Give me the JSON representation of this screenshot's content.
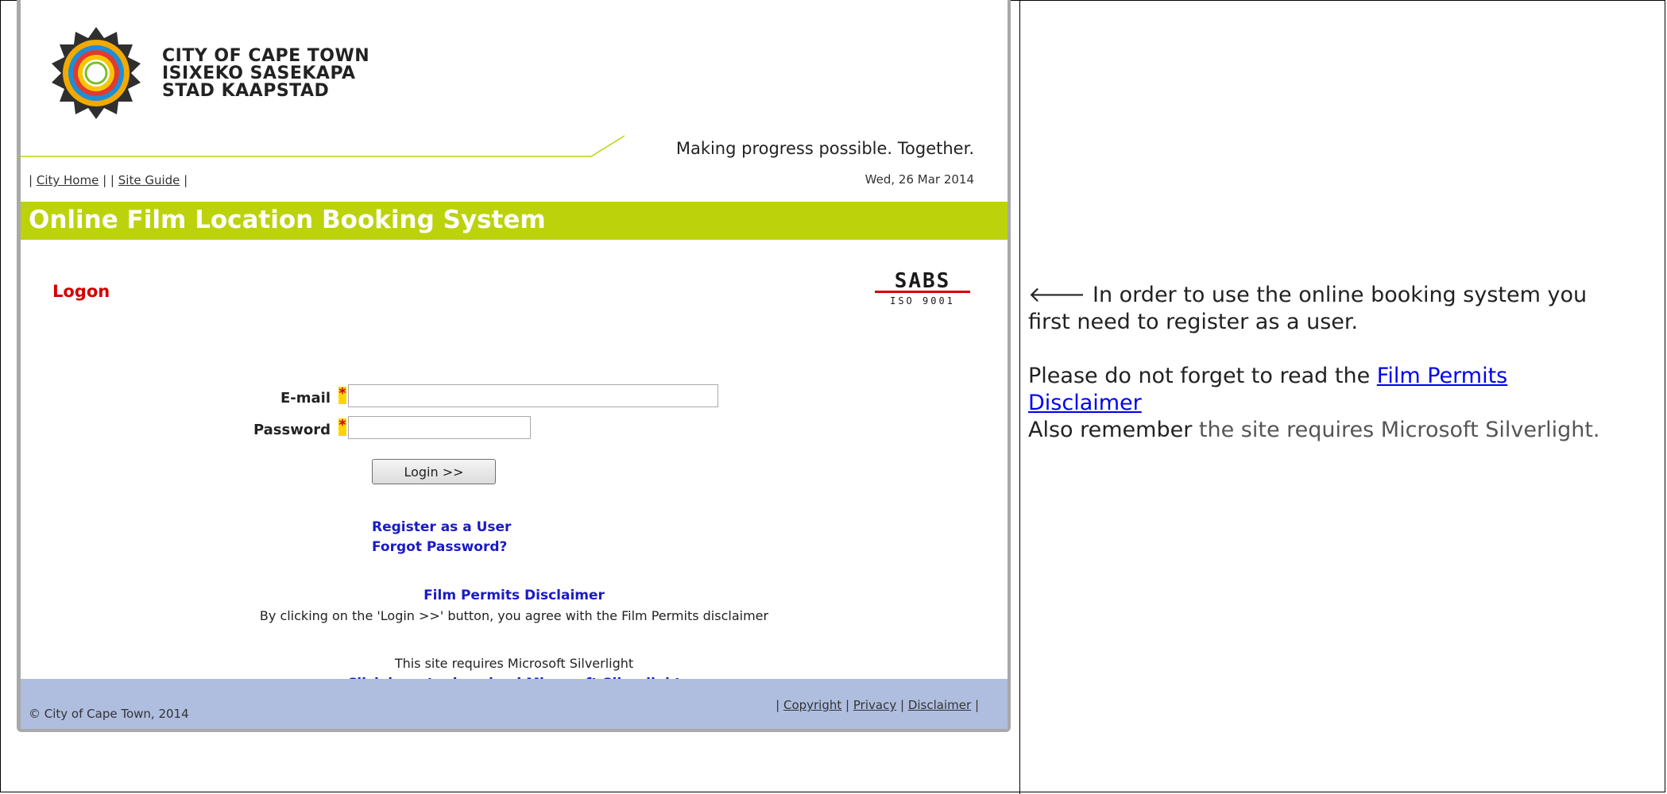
{
  "header": {
    "city_names": [
      "CITY OF CAPE TOWN",
      "ISIXEKO SASEKAPA",
      "STAD KAAPSTAD"
    ],
    "tagline": "Making progress possible. Together.",
    "nav": {
      "sep_open": "|",
      "city_home": "City Home",
      "sep_mid": "| |",
      "site_guide": "Site Guide",
      "sep_close": "|"
    },
    "date": "Wed, 26 Mar 2014"
  },
  "title_bar": {
    "title": "Online Film Location Booking System"
  },
  "logon": {
    "heading": "Logon",
    "sabs_text": "SABS",
    "sabs_sub": "ISO 9001",
    "email_label": "E-mail",
    "password_label": "Password",
    "required_mark": "*",
    "email_value": "",
    "password_value": "",
    "login_button": "Login >>",
    "register_link": "Register as a User",
    "forgot_link": "Forgot Password?",
    "disclaimer_link": "Film Permits Disclaimer",
    "disclaimer_text": "By clicking on the 'Login >>' button, you agree with the Film Permits disclaimer",
    "silverlight_text": "This site requires Microsoft Silverlight",
    "silverlight_link": "Click here to download Microsoft Silverlight"
  },
  "footer": {
    "copyright": "© City of Cape Town, 2014",
    "sep1": "|",
    "link_copyright": "Copyright",
    "sep2": "|",
    "link_privacy": "Privacy",
    "sep3": "|",
    "link_disclaimer": "Disclaimer",
    "sep4": "|"
  },
  "note": {
    "arrow": "🡐",
    "intro": "In order to use the online booking system you first need to register as a user.",
    "read_prefix": "Please do not forget to read the ",
    "read_link": "Film Permits Disclaimer",
    "also_prefix": "Also remember",
    "also_rest": " the site requires Microsoft Silverlight."
  },
  "colors": {
    "title_bar": "#bcd30c",
    "footer": "#afbddf",
    "logon_heading": "#d40000",
    "link_blue": "#1a1ac8"
  },
  "icons": [
    "city-of-cape-town-logo",
    "sabs-iso-logo",
    "left-arrow-icon"
  ]
}
